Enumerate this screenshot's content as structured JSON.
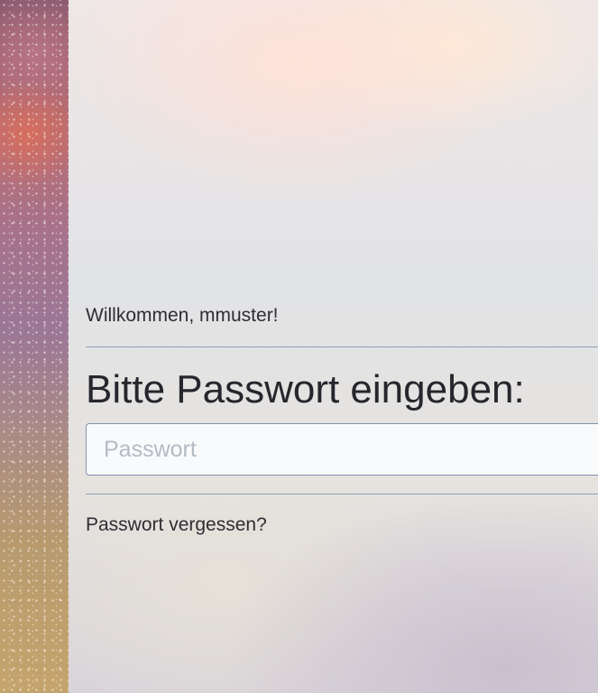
{
  "login": {
    "welcome_text": "Willkommen, mmuster!",
    "heading": "Bitte Passwort eingeben:",
    "password_value": "",
    "password_placeholder": "Passwort",
    "forgot_password_link": "Passwort vergessen?"
  },
  "colors": {
    "divider": "#8fa1b8",
    "input_border": "#7f93ad",
    "text": "#2d2d33"
  }
}
